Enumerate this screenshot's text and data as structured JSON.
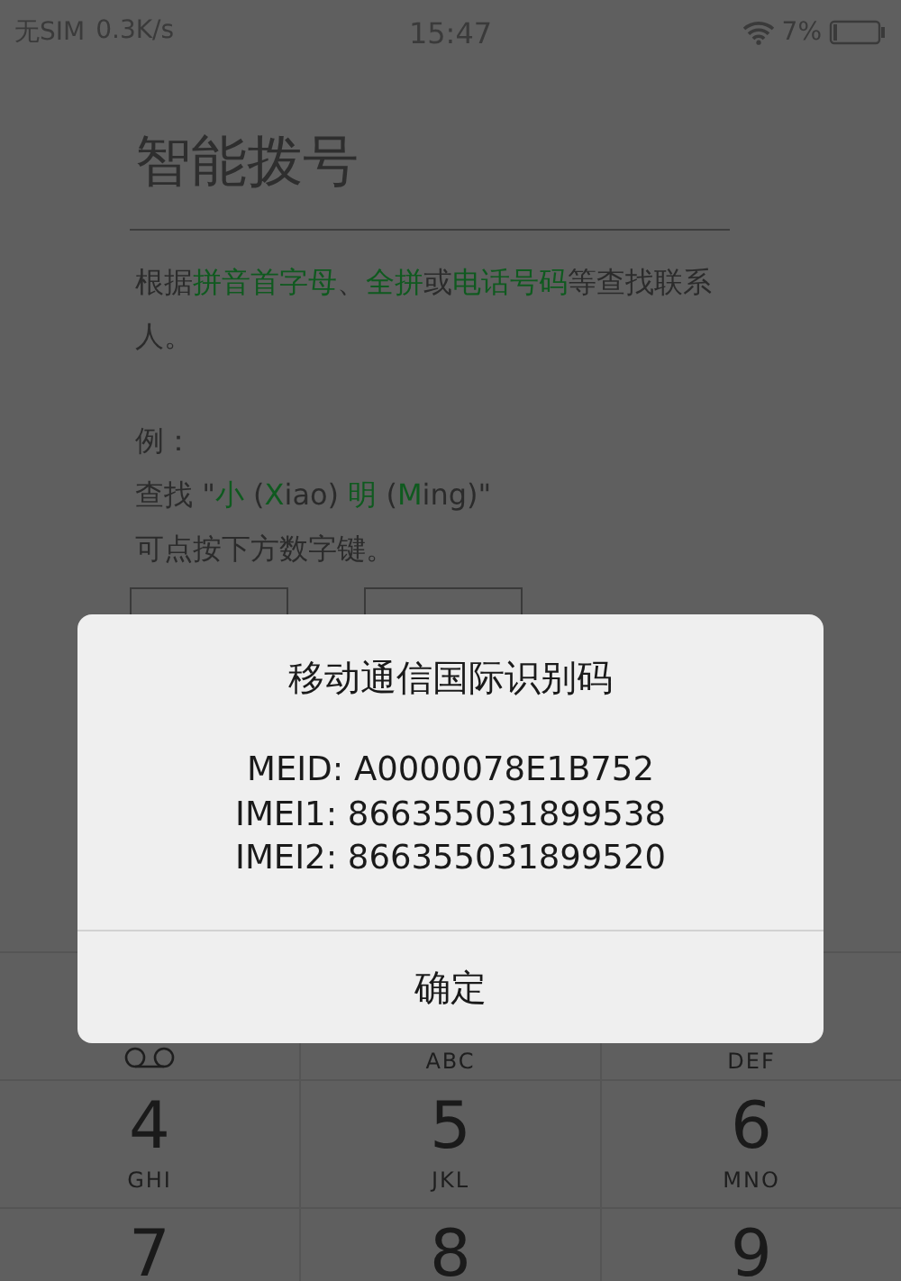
{
  "status_bar": {
    "carrier": "无SIM",
    "speed": "0.3K/s",
    "time": "15:47",
    "battery": "7%"
  },
  "title": "智能拨号",
  "description": [
    {
      "text": "根据",
      "highlight": false
    },
    {
      "text": "拼音首字母",
      "highlight": true
    },
    {
      "text": "、",
      "highlight": false
    },
    {
      "text": "全拼",
      "highlight": true
    },
    {
      "text": "或",
      "highlight": false
    },
    {
      "text": "电话号码",
      "highlight": true
    },
    {
      "text": "等查找联系人。",
      "highlight": false
    }
  ],
  "example_label": "例：",
  "example": [
    {
      "text": "查找 \"",
      "highlight": false
    },
    {
      "text": "小",
      "highlight": true
    },
    {
      "text": " (",
      "highlight": false
    },
    {
      "text": "X",
      "highlight": true
    },
    {
      "text": "iao) ",
      "highlight": false
    },
    {
      "text": "明",
      "highlight": true
    },
    {
      "text": " (",
      "highlight": false
    },
    {
      "text": "M",
      "highlight": true
    },
    {
      "text": "ing)\"",
      "highlight": false
    }
  ],
  "hint": "可点按下方数字键。",
  "keypad": [
    [
      {
        "kind": "voicemail"
      },
      {
        "kind": "letters",
        "letters": "ABC"
      },
      {
        "kind": "letters",
        "letters": "DEF"
      }
    ],
    [
      {
        "kind": "digit",
        "digit": "4",
        "letters": "GHI"
      },
      {
        "kind": "digit",
        "digit": "5",
        "letters": "JKL"
      },
      {
        "kind": "digit",
        "digit": "6",
        "letters": "MNO"
      }
    ],
    [
      {
        "kind": "digit",
        "digit": "7"
      },
      {
        "kind": "digit",
        "digit": "8"
      },
      {
        "kind": "digit",
        "digit": "9"
      }
    ]
  ],
  "dialog": {
    "title": "移动通信国际识别码",
    "lines": [
      "MEID: A0000078E1B752",
      "IMEI1: 866355031899538",
      "IMEI2: 866355031899520"
    ],
    "button": "确定"
  }
}
